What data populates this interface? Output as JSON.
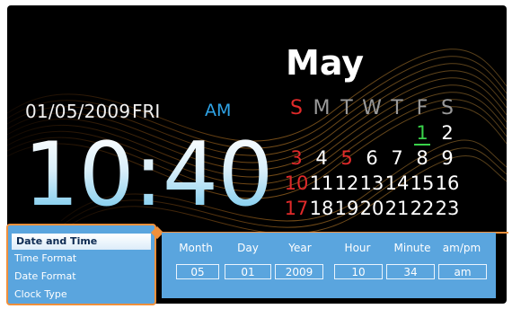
{
  "date_display": {
    "date": "01/05/2009",
    "weekday": "FRI",
    "ampm": "AM",
    "time": "10:40"
  },
  "calendar": {
    "month": "May",
    "weekday_headers": [
      "S",
      "M",
      "T",
      "W",
      "T",
      "F",
      "S"
    ],
    "rows": [
      [
        "",
        "",
        "",
        "",
        "",
        "1",
        "2"
      ],
      [
        "3",
        "4",
        "5",
        "6",
        "7",
        "8",
        "9"
      ],
      [
        "10",
        "11",
        "12",
        "13",
        "14",
        "15",
        "16"
      ],
      [
        "17",
        "18",
        "19",
        "20",
        "21",
        "22",
        "23"
      ]
    ],
    "today": "1"
  },
  "menu": {
    "items": [
      "Date and Time",
      "Time Format",
      "Date Format",
      "Clock Type"
    ],
    "selected": "Date and Time"
  },
  "settings": {
    "labels": {
      "month": "Month",
      "day": "Day",
      "year": "Year",
      "hour": "Hour",
      "minute": "Minute",
      "ampm": "am/pm"
    },
    "values": {
      "month": "05",
      "day": "01",
      "year": "2009",
      "hour": "10",
      "minute": "34",
      "ampm": "am"
    }
  },
  "colors": {
    "accent": "#f0903b",
    "panel": "#5aa5de",
    "sunday": "#e02a2a",
    "today": "#39d24a",
    "ampm": "#2fa3e6"
  }
}
